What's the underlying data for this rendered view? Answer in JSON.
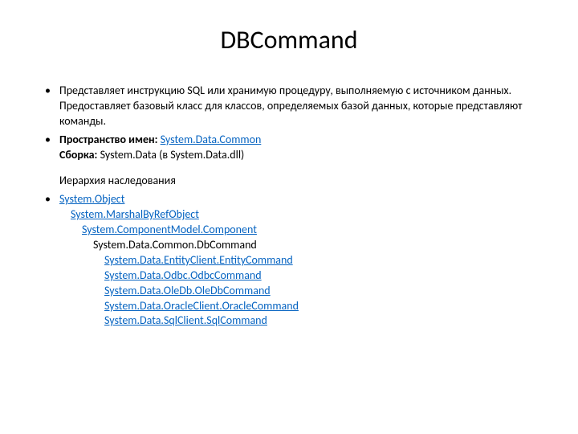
{
  "title": "DBCommand",
  "bullet1": "Представляет инструкцию SQL или хранимую процедуру, выполняемую с источником данных. Предоставляет базовый класс для классов, определяемых базой данных, которые представляют команды.",
  "namespace_label": "Пространство имен:  ",
  "namespace_link": "System.Data.Common",
  "assembly_label": "Сборка:  ",
  "assembly_value": "System.Data (в System.Data.dll)",
  "hierarchy_title": "Иерархия наследования",
  "hierarchy": {
    "l0": "System.Object",
    "l1": "System.MarshalByRefObject",
    "l2": "System.ComponentModel.Component",
    "l3": "System.Data.Common.DbCommand",
    "l4a": "System.Data.EntityClient.EntityCommand",
    "l4b": "System.Data.Odbc.OdbcCommand",
    "l4c": "System.Data.OleDb.OleDbCommand",
    "l4d": "System.Data.OracleClient.OracleCommand",
    "l4e": "System.Data.SqlClient.SqlCommand"
  }
}
